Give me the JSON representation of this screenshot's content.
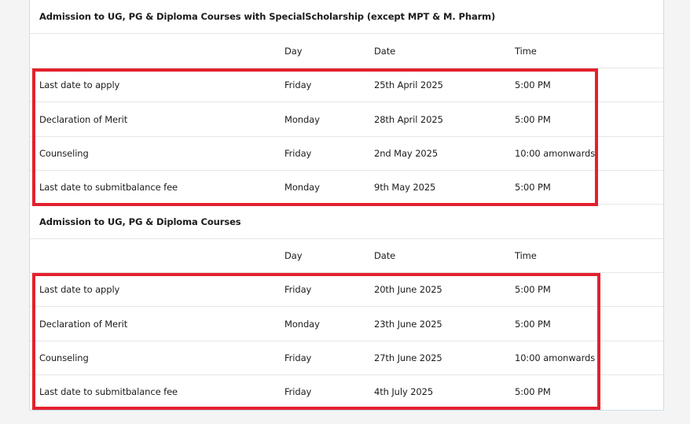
{
  "header_labels": {
    "day": "Day",
    "date": "Date",
    "time": "Time"
  },
  "sections": [
    {
      "title": "Admission to UG, PG & Diploma Courses with SpecialScholarship (except MPT & M. Pharm)",
      "rows": [
        {
          "event": "Last date to apply",
          "day": "Friday",
          "date": "25th April 2025",
          "time": "5:00 PM"
        },
        {
          "event": "Declaration of Merit",
          "day": "Monday",
          "date": "28th April 2025",
          "time": "5:00 PM"
        },
        {
          "event": "Counseling",
          "day": "Friday",
          "date": "2nd May 2025",
          "time": "10:00 amonwards"
        },
        {
          "event": "Last date to submitbalance fee",
          "day": "Monday",
          "date": "9th May 2025",
          "time": "5:00 PM"
        }
      ]
    },
    {
      "title": "Admission to UG, PG & Diploma Courses",
      "rows": [
        {
          "event": "Last date to apply",
          "day": "Friday",
          "date": "20th June 2025",
          "time": "5:00 PM"
        },
        {
          "event": "Declaration of Merit",
          "day": "Monday",
          "date": "23th June 2025",
          "time": "5:00 PM"
        },
        {
          "event": "Counseling",
          "day": "Friday",
          "date": "27th June 2025",
          "time": "10:00 amonwards"
        },
        {
          "event": "Last date to submitbalance fee",
          "day": "Friday",
          "date": "4th July 2025",
          "time": "5:00 PM"
        }
      ]
    }
  ],
  "colors": {
    "highlight": "#e3212e",
    "panel_border": "#c9dfec",
    "row_divider": "#e6e6e6"
  }
}
